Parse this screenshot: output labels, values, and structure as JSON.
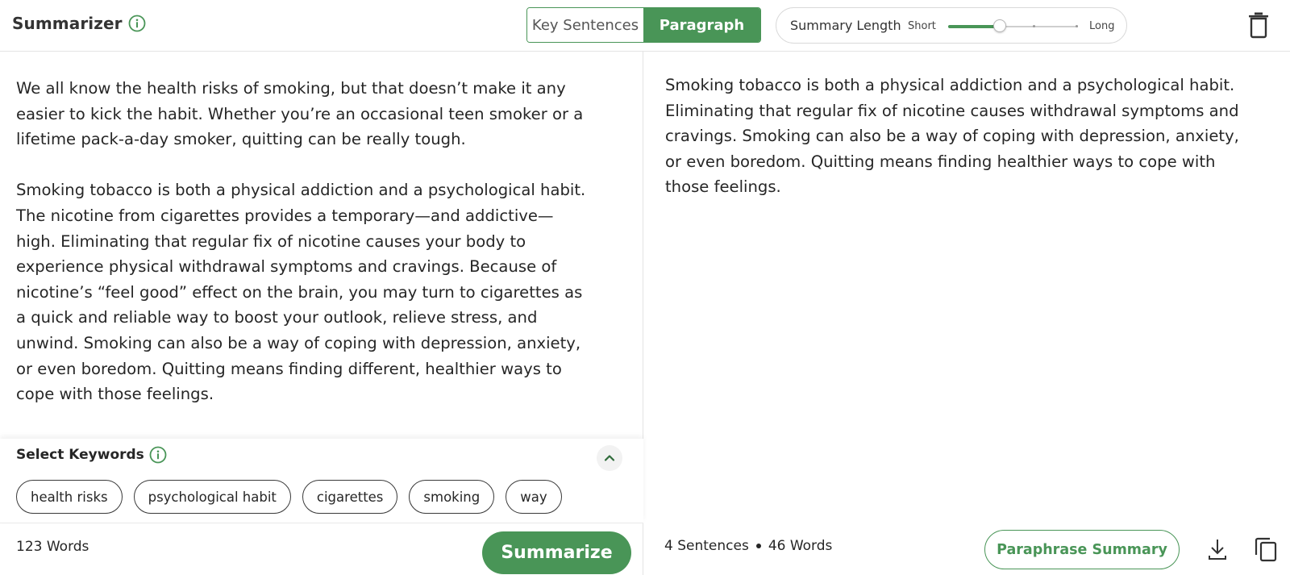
{
  "header": {
    "title": "Summarizer",
    "info_icon": "info-circle-icon",
    "modes": [
      {
        "label": "Key Sentences",
        "active": false
      },
      {
        "label": "Paragraph",
        "active": true
      }
    ],
    "summary_length": {
      "label": "Summary Length",
      "min_label": "Short",
      "max_label": "Long",
      "value": 0.4
    },
    "delete_icon": "trash-icon"
  },
  "input": {
    "paragraphs": [
      "We all know the health risks of smoking, but that doesn’t make it any easier to kick the habit. Whether you’re an occasional teen smoker or a lifetime pack-a-day smoker, quitting can be really tough.",
      "Smoking tobacco is both a physical addiction and a psychological habit. The nicotine from cigarettes provides a temporary—and addictive—high. Eliminating that regular fix of nicotine causes your body to experience physical withdrawal symptoms and cravings. Because of nicotine’s “feel good” effect on the brain, you may turn to cigarettes as a quick and reliable way to boost your outlook, relieve stress, and unwind. Smoking can also be a way of coping with depression, anxiety, or even boredom. Quitting means finding different, healthier ways to cope with those feelings."
    ],
    "keywords_title": "Select Keywords",
    "keywords": [
      "health risks",
      "psychological habit",
      "cigarettes",
      "smoking",
      "way"
    ],
    "word_count": "123 Words",
    "summarize_label": "Summarize"
  },
  "output": {
    "summary": "Smoking tobacco is both a physical addiction and a psychological habit. Eliminating that regular fix of nicotine causes withdrawal symptoms and cravings. Smoking can also be a way of coping with depression, anxiety, or even boredom. Quitting means finding healthier ways to cope with those feelings.",
    "sentences": "4 Sentences",
    "words": "46 Words",
    "paraphrase_label": "Paraphrase Summary",
    "download_icon": "download-icon",
    "copy_icon": "copy-icon"
  },
  "colors": {
    "accent": "#499557",
    "text": "#262626",
    "border": "#e4e4e4"
  }
}
